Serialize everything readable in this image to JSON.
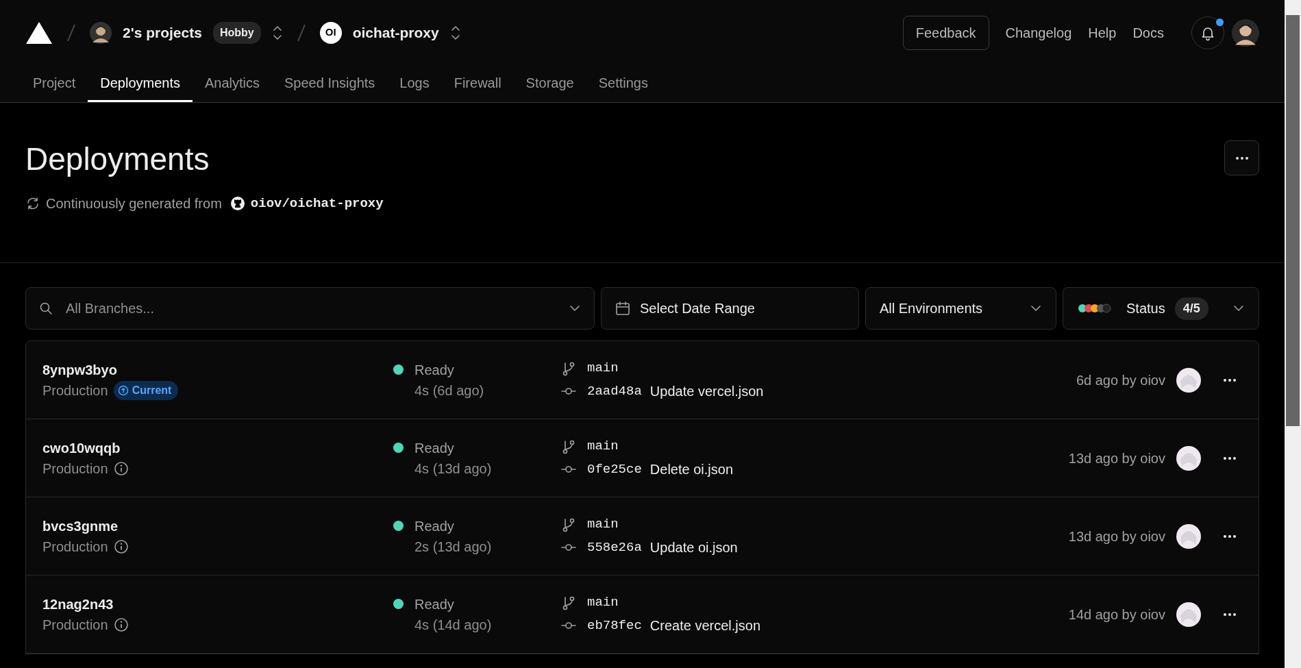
{
  "header": {
    "team": "2's projects",
    "plan": "Hobby",
    "project": "oichat-proxy",
    "project_logo": "OI",
    "feedback": "Feedback",
    "links": [
      "Changelog",
      "Help",
      "Docs"
    ],
    "notification_unread": true
  },
  "tabs": [
    {
      "label": "Project",
      "selected": false
    },
    {
      "label": "Deployments",
      "selected": true
    },
    {
      "label": "Analytics",
      "selected": false
    },
    {
      "label": "Speed Insights",
      "selected": false
    },
    {
      "label": "Logs",
      "selected": false
    },
    {
      "label": "Firewall",
      "selected": false
    },
    {
      "label": "Storage",
      "selected": false
    },
    {
      "label": "Settings",
      "selected": false
    }
  ],
  "page": {
    "title": "Deployments",
    "source_label": "Continuously generated from",
    "repo": "oiov/oichat-proxy"
  },
  "filters": {
    "branch_placeholder": "All Branches...",
    "date_range": "Select Date Range",
    "environment": "All Environments",
    "status_label": "Status",
    "status_count": "4/5"
  },
  "deployments": [
    {
      "id": "8ynpw3byo",
      "environment": "Production",
      "current": true,
      "current_label": "Current",
      "status": "Ready",
      "duration": "4s (6d ago)",
      "branch": "main",
      "commit": "2aad48a",
      "message": "Update vercel.json",
      "time": "6d ago by oiov"
    },
    {
      "id": "cwo10wqqb",
      "environment": "Production",
      "current": false,
      "status": "Ready",
      "duration": "4s (13d ago)",
      "branch": "main",
      "commit": "0fe25ce",
      "message": "Delete oi.json",
      "time": "13d ago by oiov"
    },
    {
      "id": "bvcs3gnme",
      "environment": "Production",
      "current": false,
      "status": "Ready",
      "duration": "2s (13d ago)",
      "branch": "main",
      "commit": "558e26a",
      "message": "Update oi.json",
      "time": "13d ago by oiov"
    },
    {
      "id": "12nag2n43",
      "environment": "Production",
      "current": false,
      "status": "Ready",
      "duration": "4s (14d ago)",
      "branch": "main",
      "commit": "eb78fec",
      "message": "Create vercel.json",
      "time": "14d ago by oiov"
    }
  ]
}
